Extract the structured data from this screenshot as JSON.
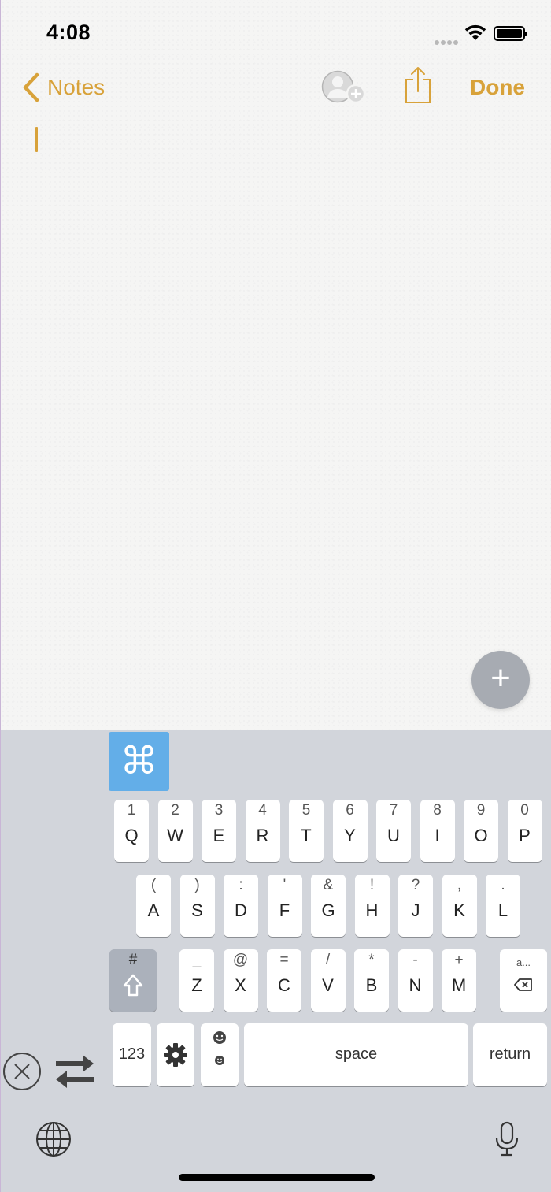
{
  "status_bar": {
    "time": "4:08",
    "signal_icon": "signal-dots-icon",
    "wifi_icon": "wifi-icon",
    "battery_icon": "battery-icon"
  },
  "nav": {
    "back_label": "Notes",
    "done_label": "Done",
    "add_person_icon": "add-person-icon",
    "share_icon": "share-icon"
  },
  "fab": {
    "symbol": "+"
  },
  "keyboard": {
    "command_symbol": "⌘",
    "row1": [
      {
        "hint": "1",
        "main": "Q"
      },
      {
        "hint": "2",
        "main": "W"
      },
      {
        "hint": "3",
        "main": "E"
      },
      {
        "hint": "4",
        "main": "R"
      },
      {
        "hint": "5",
        "main": "T"
      },
      {
        "hint": "6",
        "main": "Y"
      },
      {
        "hint": "7",
        "main": "U"
      },
      {
        "hint": "8",
        "main": "I"
      },
      {
        "hint": "9",
        "main": "O"
      },
      {
        "hint": "0",
        "main": "P"
      }
    ],
    "row2": [
      {
        "hint": "(",
        "main": "A"
      },
      {
        "hint": ")",
        "main": "S"
      },
      {
        "hint": ":",
        "main": "D"
      },
      {
        "hint": "'",
        "main": "F"
      },
      {
        "hint": "&",
        "main": "G"
      },
      {
        "hint": "!",
        "main": "H"
      },
      {
        "hint": "?",
        "main": "J"
      },
      {
        "hint": ",",
        "main": "K"
      },
      {
        "hint": ".",
        "main": "L"
      }
    ],
    "row3": [
      {
        "hint": "_",
        "main": "Z"
      },
      {
        "hint": "@",
        "main": "X"
      },
      {
        "hint": "=",
        "main": "C"
      },
      {
        "hint": "/",
        "main": "V"
      },
      {
        "hint": "*",
        "main": "B"
      },
      {
        "hint": "-",
        "main": "N"
      },
      {
        "hint": "+",
        "main": "M"
      }
    ],
    "shift_hint": "#",
    "delete_hint": "a...",
    "numbers_label": "123",
    "space_label": "space",
    "return_label": "return",
    "accent_color": "#d8a23a",
    "command_color": "#63aee8"
  }
}
